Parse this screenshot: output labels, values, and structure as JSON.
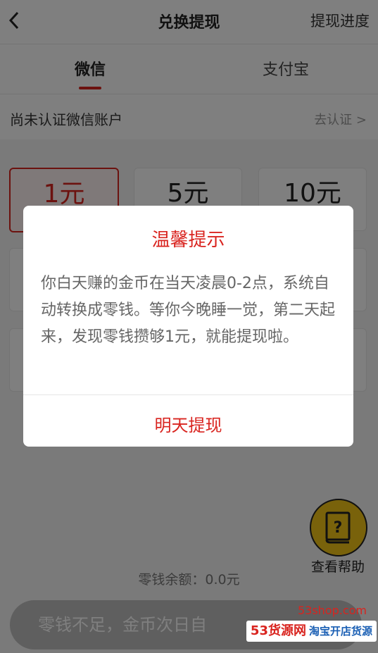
{
  "header": {
    "title": "兑换提现",
    "progress_link": "提现进度"
  },
  "tabs": [
    {
      "label": "微信",
      "active": true
    },
    {
      "label": "支付宝",
      "active": false
    }
  ],
  "auth": {
    "label": "尚未认证微信账户",
    "link": "去认证 >"
  },
  "amounts": [
    {
      "label": "1元",
      "selected": true
    },
    {
      "label": "5元"
    },
    {
      "label": "10元"
    }
  ],
  "help": {
    "label": "查看帮助",
    "icon": "help-book-icon"
  },
  "balance": "零钱余额：0.0元",
  "bottom_button": "零钱不足，金币次日自",
  "dialog": {
    "title": "温馨提示",
    "body": "你白天赚的金币在当天凌晨0-2点，系统自动转换成零钱。等你今晚睡一觉，第二天起来，发现零钱攒够1元，就能提现啦。",
    "confirm": "明天提现"
  },
  "watermark": {
    "site": "53shop.com",
    "brand": "53货源网",
    "slogan": "淘宝开店货源"
  },
  "colors": {
    "accent": "#d9241f",
    "help_bg": "#f2c417"
  }
}
